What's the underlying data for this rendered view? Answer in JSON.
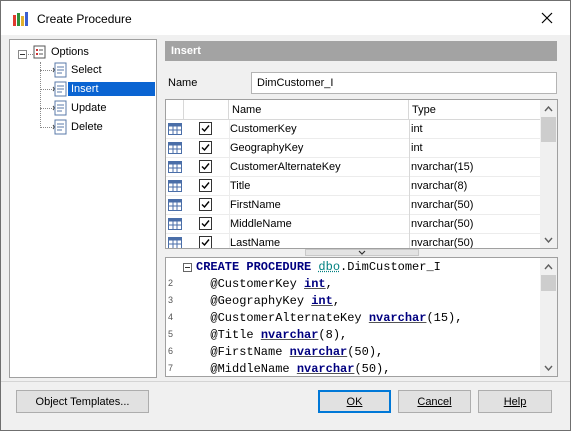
{
  "window": {
    "title": "Create Procedure"
  },
  "tree": {
    "root": "Options",
    "items": [
      {
        "label": "Select"
      },
      {
        "label": "Insert"
      },
      {
        "label": "Update"
      },
      {
        "label": "Delete"
      }
    ],
    "selected": "Insert"
  },
  "section": {
    "title": "Insert"
  },
  "name_field": {
    "label": "Name",
    "value": "DimCustomer_I"
  },
  "grid": {
    "columns": [
      "Name",
      "Type"
    ],
    "rows": [
      {
        "name": "CustomerKey",
        "type": "int",
        "checked": true
      },
      {
        "name": "GeographyKey",
        "type": "int",
        "checked": true
      },
      {
        "name": "CustomerAlternateKey",
        "type": "nvarchar(15)",
        "checked": true
      },
      {
        "name": "Title",
        "type": "nvarchar(8)",
        "checked": true
      },
      {
        "name": "FirstName",
        "type": "nvarchar(50)",
        "checked": true
      },
      {
        "name": "MiddleName",
        "type": "nvarchar(50)",
        "checked": true
      },
      {
        "name": "LastName",
        "type": "nvarchar(50)",
        "checked": true
      }
    ]
  },
  "code": {
    "lines": [
      {
        "n": "",
        "parts": [
          [
            "kw",
            "CREATE PROCEDURE "
          ],
          [
            "sch",
            "dbo"
          ],
          [
            "pn",
            ".DimCustomer_I"
          ]
        ]
      },
      {
        "n": "2",
        "parts": [
          [
            "pn",
            "  @CustomerKey "
          ],
          [
            "ty",
            "int"
          ],
          [
            "pn",
            ","
          ]
        ]
      },
      {
        "n": "3",
        "parts": [
          [
            "pn",
            "  @GeographyKey "
          ],
          [
            "ty",
            "int"
          ],
          [
            "pn",
            ","
          ]
        ]
      },
      {
        "n": "4",
        "parts": [
          [
            "pn",
            "  @CustomerAlternateKey "
          ],
          [
            "ty",
            "nvarchar"
          ],
          [
            "pn",
            "(15),"
          ]
        ]
      },
      {
        "n": "5",
        "parts": [
          [
            "pn",
            "  @Title "
          ],
          [
            "ty",
            "nvarchar"
          ],
          [
            "pn",
            "(8),"
          ]
        ]
      },
      {
        "n": "6",
        "parts": [
          [
            "pn",
            "  @FirstName "
          ],
          [
            "ty",
            "nvarchar"
          ],
          [
            "pn",
            "(50),"
          ]
        ]
      },
      {
        "n": "7",
        "parts": [
          [
            "pn",
            "  @MiddleName "
          ],
          [
            "ty",
            "nvarchar"
          ],
          [
            "pn",
            "(50),"
          ]
        ]
      }
    ]
  },
  "buttons": {
    "templates": "Object Templates...",
    "ok": "OK",
    "cancel": "Cancel",
    "help": "Help"
  },
  "colors": {
    "selection": "#0a64d2",
    "header": "#a3a3a3",
    "keyword": "#000080",
    "schema": "#008080"
  }
}
